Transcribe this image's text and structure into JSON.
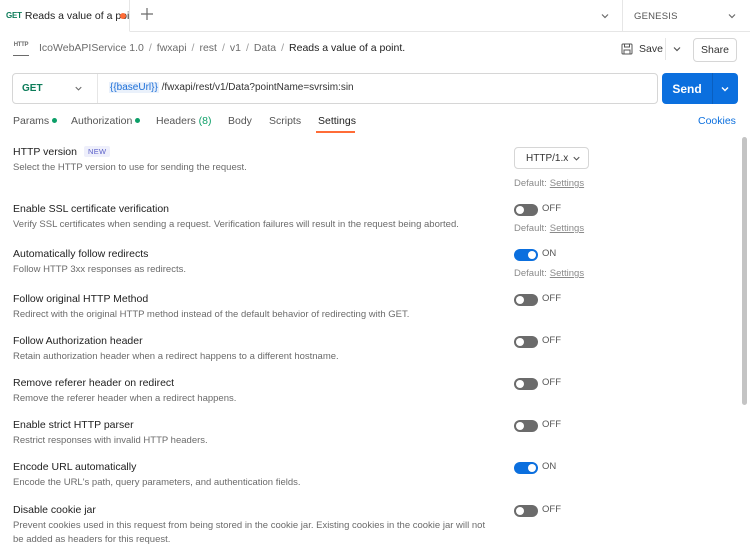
{
  "tabbar": {
    "request_tab": {
      "method": "GET",
      "title": "Reads a value of a poin"
    },
    "environment": "GENESIS"
  },
  "breadcrumb": {
    "items": [
      "IcoWebAPIService 1.0",
      "fwxapi",
      "rest",
      "v1",
      "Data"
    ],
    "current": "Reads a value of a point.",
    "save_label": "Save",
    "share_label": "Share"
  },
  "urlbar": {
    "method": "GET",
    "url_variable": "{{baseUrl}}",
    "url_path": " /fwxapi/rest/v1/Data?pointName=svrsim:sin",
    "send_label": "Send"
  },
  "request_tabs": {
    "params": "Params",
    "authorization": "Authorization",
    "headers": "Headers",
    "headers_count": "(8)",
    "body": "Body",
    "scripts": "Scripts",
    "settings": "Settings",
    "cookies": "Cookies"
  },
  "settings": {
    "default_label": "Default:",
    "default_link": "Settings",
    "items": [
      {
        "title": "HTTP version",
        "badge": "NEW",
        "desc": "Select the HTTP version to use for sending the request.",
        "select_value": "HTTP/1.x"
      },
      {
        "title": "Enable SSL certificate verification",
        "desc": "Verify SSL certificates when sending a request. Verification failures will result in the request being aborted.",
        "state": "OFF"
      },
      {
        "title": "Automatically follow redirects",
        "desc": "Follow HTTP 3xx responses as redirects.",
        "state": "ON"
      },
      {
        "title": "Follow original HTTP Method",
        "desc": "Redirect with the original HTTP method instead of the default behavior of redirecting with GET.",
        "state": "OFF"
      },
      {
        "title": "Follow Authorization header",
        "desc": "Retain authorization header when a redirect happens to a different hostname.",
        "state": "OFF"
      },
      {
        "title": "Remove referer header on redirect",
        "desc": "Remove the referer header when a redirect happens.",
        "state": "OFF"
      },
      {
        "title": "Enable strict HTTP parser",
        "desc": "Restrict responses with invalid HTTP headers.",
        "state": "OFF"
      },
      {
        "title": "Encode URL automatically",
        "desc": "Encode the URL's path, query parameters, and authentication fields.",
        "state": "ON"
      },
      {
        "title": "Disable cookie jar",
        "desc": "Prevent cookies used in this request from being stored in the cookie jar. Existing cookies in the cookie jar will not be added as headers for this request.",
        "state": "OFF"
      }
    ]
  },
  "colors": {
    "accent": "#0b6fde",
    "method_get": "#0c7c59",
    "active_tab": "#ff6c37",
    "status_dot": "#0c9f68"
  },
  "icons": [
    "plus-icon",
    "chevron-down-icon",
    "http-icon",
    "save-icon"
  ]
}
